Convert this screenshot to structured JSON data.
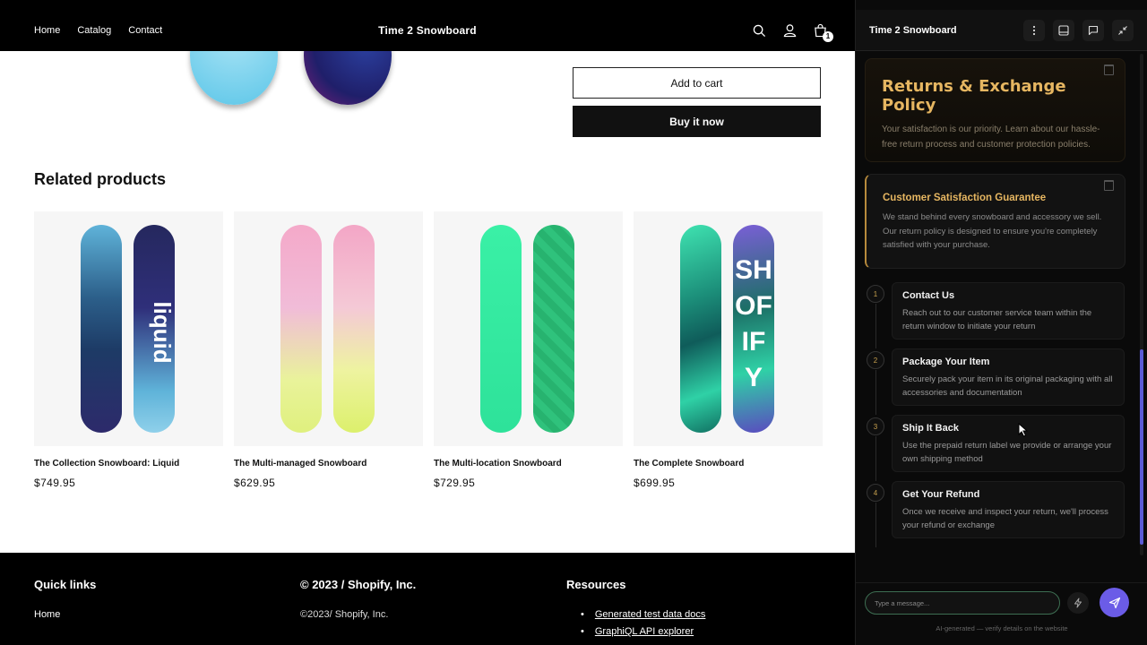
{
  "store": {
    "nav": [
      "Home",
      "Catalog",
      "Contact"
    ],
    "brand": "Time 2 Snowboard",
    "cart_count": "1",
    "add_to_cart": "Add to cart",
    "buy_now": "Buy it now",
    "related_title": "Related products",
    "products": [
      {
        "name": "The Collection Snowboard: Liquid",
        "price": "$749.95"
      },
      {
        "name": "The Multi-managed Snowboard",
        "price": "$629.95"
      },
      {
        "name": "The Multi-location Snowboard",
        "price": "$729.95"
      },
      {
        "name": "The Complete Snowboard",
        "price": "$699.95"
      }
    ],
    "footer": {
      "quick_links_title": "Quick links",
      "quick_links": [
        "Home"
      ],
      "copyright_title": "© 2023 / Shopify, Inc.",
      "copyright_text": "©2023/ Shopify, Inc.",
      "resources_title": "Resources",
      "resources": [
        "Generated test data docs",
        "GraphiQL API explorer"
      ]
    }
  },
  "panel": {
    "title": "Time 2 Snowboard",
    "hero_title": "Returns & Exchange Policy",
    "hero_desc": "Your satisfaction is our priority. Learn about our hassle-free return process and customer protection policies.",
    "guarantee_title": "Customer Satisfaction Guarantee",
    "guarantee_desc": "We stand behind every snowboard and accessory we sell. Our return policy is designed to ensure you're completely satisfied with your purchase.",
    "steps": [
      {
        "num": "1",
        "title": "Contact Us",
        "desc": "Reach out to our customer service team within the return window to initiate your return"
      },
      {
        "num": "2",
        "title": "Package Your Item",
        "desc": "Securely pack your item in its original packaging with all accessories and documentation"
      },
      {
        "num": "3",
        "title": "Ship It Back",
        "desc": "Use the prepaid return label we provide or arrange your own shipping method"
      },
      {
        "num": "4",
        "title": "Get Your Refund",
        "desc": "Once we receive and inspect your return, we'll process your refund or exchange"
      }
    ],
    "input_placeholder": "Type a message...",
    "disclaimer": "AI-generated — verify details on the website"
  },
  "colors": {
    "accent_gold": "#e6b661",
    "send_button": "#6b5ce7",
    "input_border": "#3d6e52"
  },
  "icons": [
    "search-icon",
    "account-icon",
    "cart-icon",
    "more-vertical-icon",
    "panel-icon",
    "chat-icon",
    "collapse-icon",
    "trash-icon",
    "lightning-icon",
    "send-icon"
  ]
}
